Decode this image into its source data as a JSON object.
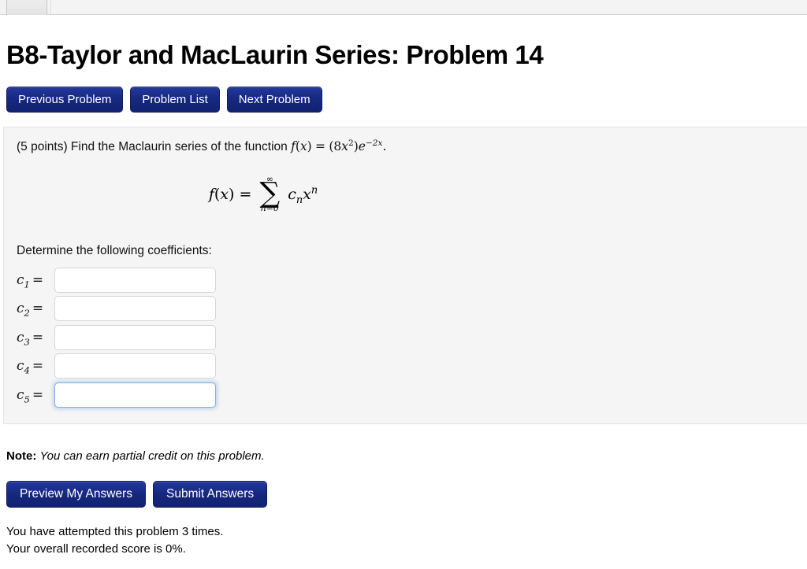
{
  "browser": {
    "tab_label": ""
  },
  "header": {
    "title": "B8-Taylor and MacLaurin Series: Problem 14"
  },
  "nav": {
    "previous_label": "Previous Problem",
    "list_label": "Problem List",
    "next_label": "Next Problem"
  },
  "problem": {
    "points_text": "(5 points) Find the Maclaurin series of the function",
    "function_expression": "f(x) = (8x^2)e^{-2x}.",
    "function_parts": {
      "f": "f",
      "paren_open": "(",
      "var": "x",
      "paren_close": ")",
      "equals": "=",
      "group_open": "(",
      "coefficient": "8",
      "x": "x",
      "x_power": "2",
      "group_close": ")",
      "e": "e",
      "e_exponent": "−2x",
      "period": "."
    },
    "display_equation": {
      "lhs_f": "f",
      "lhs_paren_open": "(",
      "lhs_var": "x",
      "lhs_paren_close": ")",
      "equals": "=",
      "sigma": "∑",
      "upper_limit": "∞",
      "lower_limit": "n=0",
      "term_c": "c",
      "term_c_sub": "n",
      "term_x": "x",
      "term_x_sup": "n"
    },
    "determine_label": "Determine the following coefficients:",
    "coefficients": [
      {
        "label_c": "c",
        "label_sub": "1",
        "equals": "=",
        "value": "",
        "placeholder": "",
        "focused": false
      },
      {
        "label_c": "c",
        "label_sub": "2",
        "equals": "=",
        "value": "",
        "placeholder": "",
        "focused": false
      },
      {
        "label_c": "c",
        "label_sub": "3",
        "equals": "=",
        "value": "",
        "placeholder": "",
        "focused": false
      },
      {
        "label_c": "c",
        "label_sub": "4",
        "equals": "=",
        "value": "",
        "placeholder": "",
        "focused": false
      },
      {
        "label_c": "c",
        "label_sub": "5",
        "equals": "=",
        "value": "",
        "placeholder": "",
        "focused": true
      }
    ]
  },
  "note": {
    "prefix": "Note:",
    "text": "You can earn partial credit on this problem."
  },
  "actions": {
    "preview_label": "Preview My Answers",
    "submit_label": "Submit Answers"
  },
  "status": {
    "attempts_line": "You have attempted this problem 3 times.",
    "score_line": "Your overall recorded score is 0%."
  },
  "colors": {
    "button_blue": "#16297e",
    "panel_background": "#f5f5f5",
    "focus_blue": "#7fb2e5",
    "input_border": "#d6d6d6",
    "page_background": "#ffffff"
  }
}
